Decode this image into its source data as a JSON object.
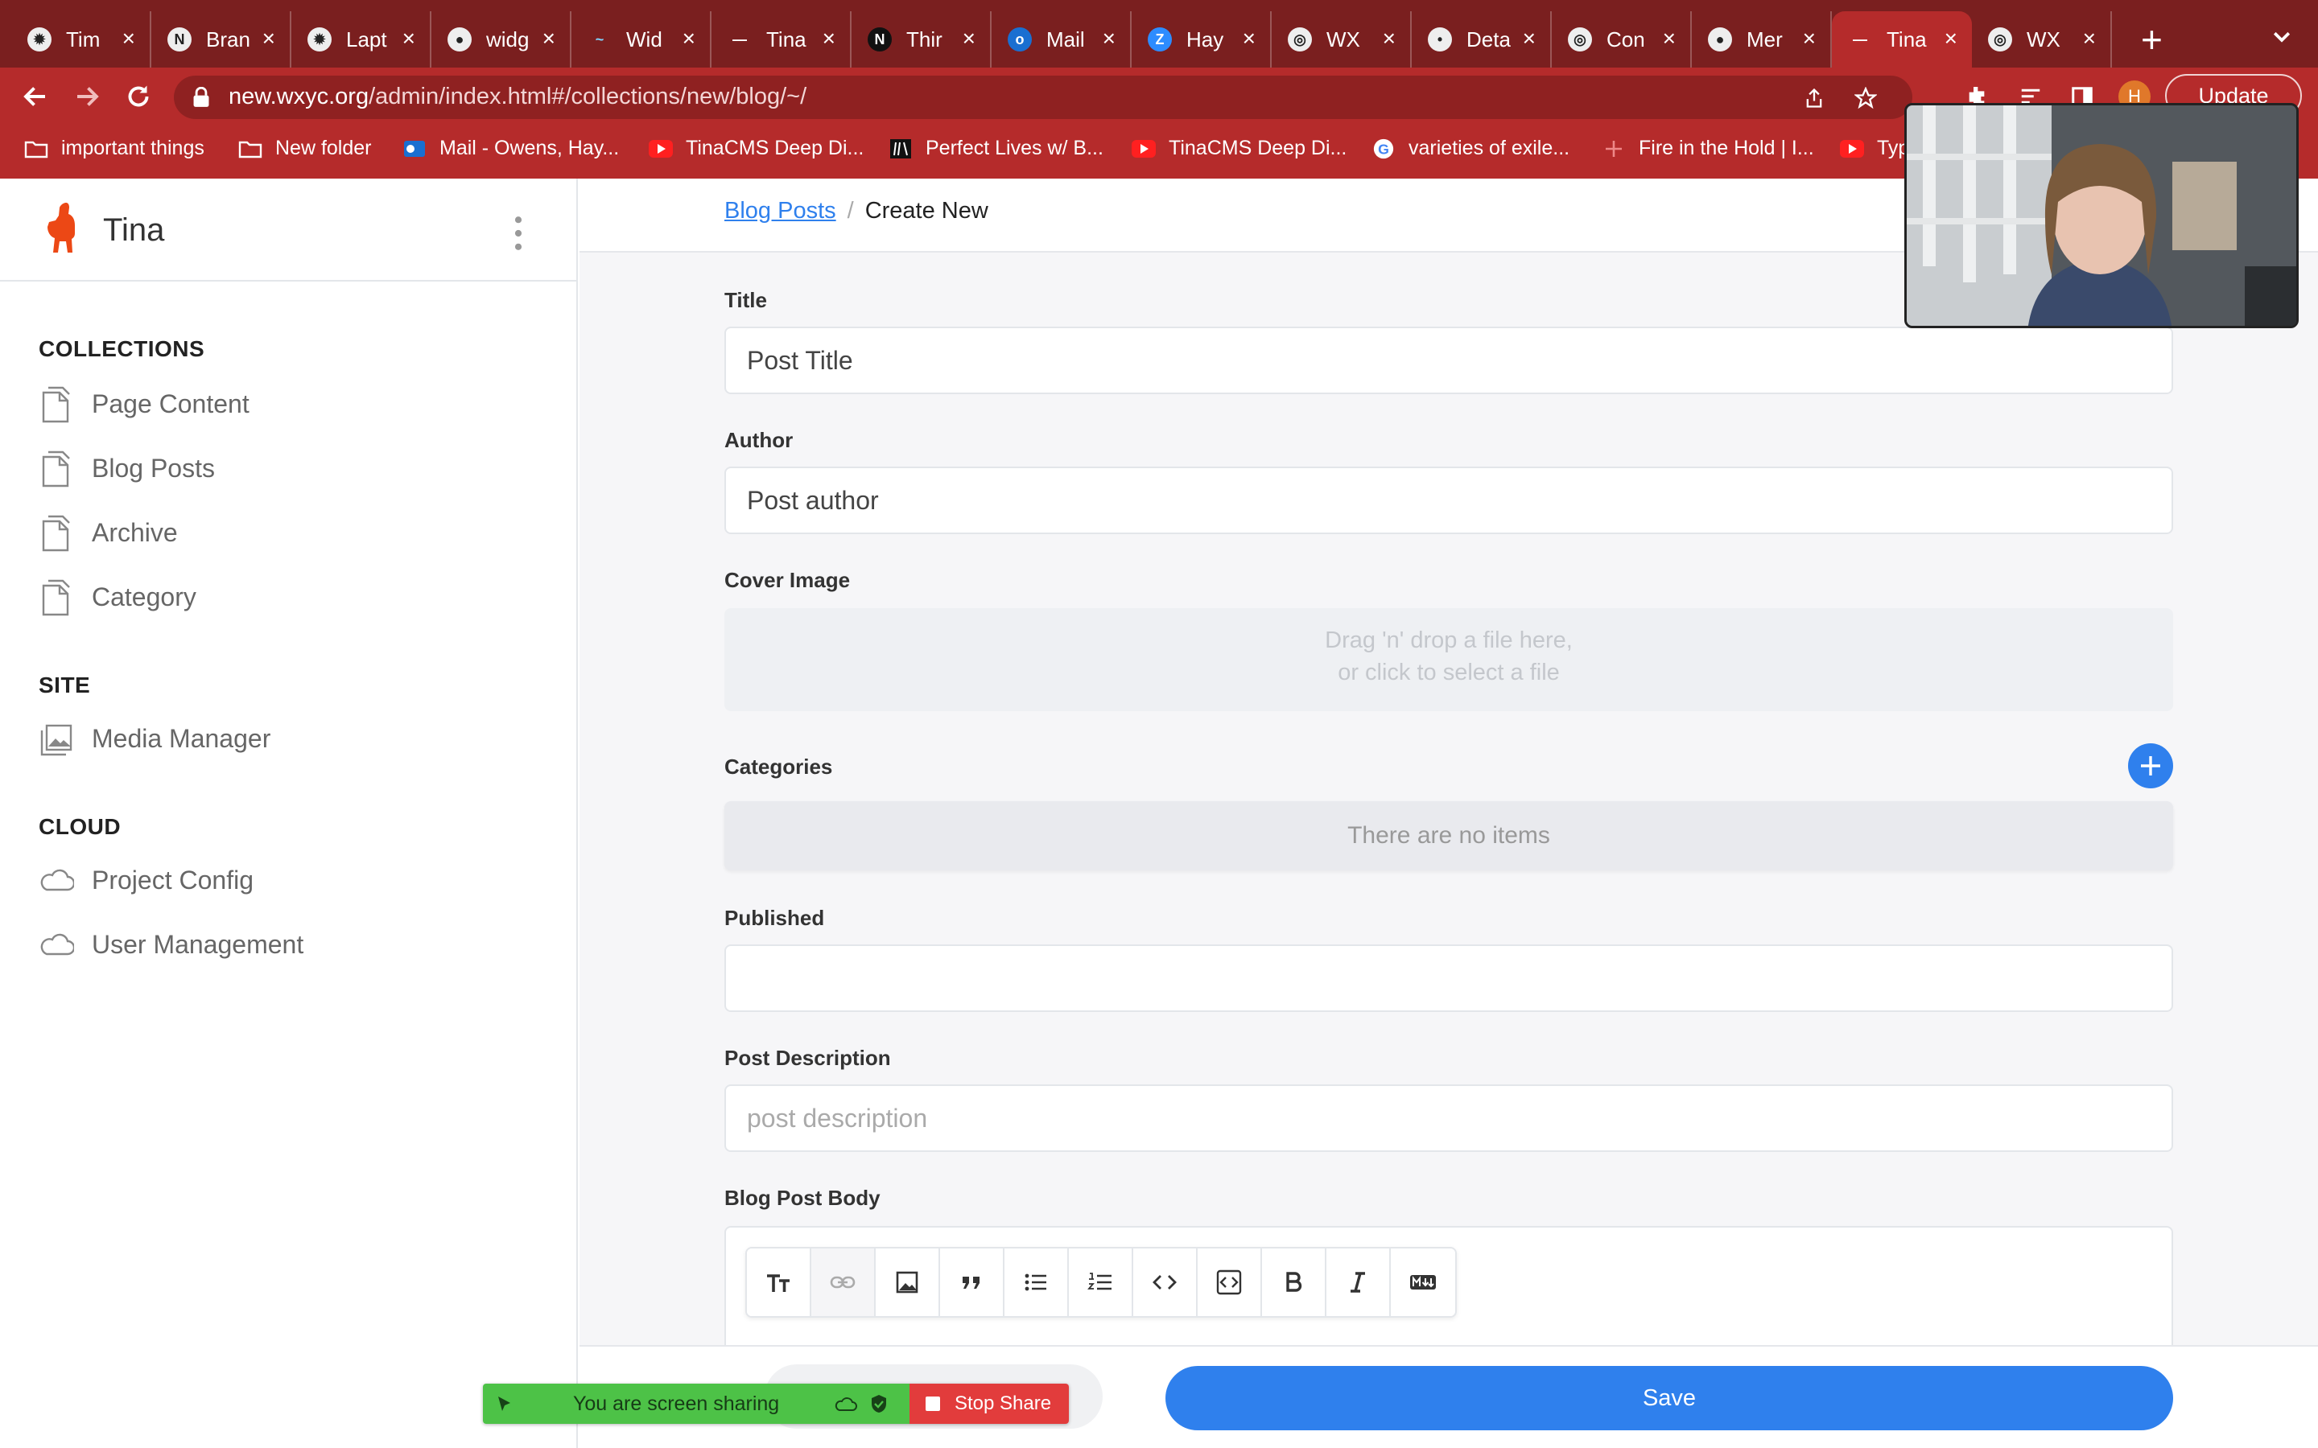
{
  "browser": {
    "tabs": [
      {
        "label": "Tim",
        "icon": "openai-icon",
        "active": false
      },
      {
        "label": "Bran",
        "icon": "notion-icon",
        "active": false
      },
      {
        "label": "Lapt",
        "icon": "chatgpt-icon",
        "active": false
      },
      {
        "label": "widg",
        "icon": "github-icon",
        "active": false
      },
      {
        "label": "Wid",
        "icon": "tailwind-icon",
        "active": false
      },
      {
        "label": "Tina",
        "icon": "wxyc-icon",
        "active": false
      },
      {
        "label": "Thir",
        "icon": "nextjs-icon",
        "active": false
      },
      {
        "label": "Mail",
        "icon": "outlook-icon",
        "active": false
      },
      {
        "label": "Hay",
        "icon": "zoom-icon",
        "active": false
      },
      {
        "label": "WX",
        "icon": "globe-icon",
        "active": false
      },
      {
        "label": "Deta",
        "icon": "site-icon",
        "active": false
      },
      {
        "label": "Con",
        "icon": "globe-icon",
        "active": false
      },
      {
        "label": "Mer",
        "icon": "github-icon",
        "active": false
      },
      {
        "label": "Tina",
        "icon": "wxyc-icon",
        "active": true
      },
      {
        "label": "WX",
        "icon": "globe-icon",
        "active": false
      }
    ],
    "url_host": "new.wxyc.org",
    "url_path": "/admin/index.html#/collections/new/blog/~/",
    "update_label": "Update",
    "profile_initial": "H",
    "bookmarks": [
      {
        "label": "important things",
        "icon": "folder-icon"
      },
      {
        "label": "New folder",
        "icon": "folder-icon"
      },
      {
        "label": "Mail - Owens, Hay...",
        "icon": "outlook-icon"
      },
      {
        "label": "TinaCMS Deep Di...",
        "icon": "youtube-icon"
      },
      {
        "label": "Perfect Lives w/ B...",
        "icon": "site-icon"
      },
      {
        "label": "TinaCMS Deep Di...",
        "icon": "youtube-icon"
      },
      {
        "label": "varieties of exile...",
        "icon": "google-icon"
      },
      {
        "label": "Fire in the Hold | I...",
        "icon": "plus-icon"
      },
      {
        "label": "Typ",
        "icon": "youtube-icon"
      }
    ]
  },
  "sidebar": {
    "brand": "Tina",
    "sections": [
      {
        "heading": "COLLECTIONS",
        "items": [
          "Page Content",
          "Blog Posts",
          "Archive",
          "Category"
        ]
      },
      {
        "heading": "SITE",
        "items": [
          "Media Manager"
        ]
      },
      {
        "heading": "CLOUD",
        "items": [
          "Project Config",
          "User Management"
        ]
      }
    ]
  },
  "main": {
    "breadcrumb": {
      "parent": "Blog Posts",
      "separator": "/",
      "current": "Create New"
    },
    "fields": {
      "title": {
        "label": "Title",
        "value": "Post Title"
      },
      "author": {
        "label": "Author",
        "value": "Post author"
      },
      "cover": {
        "label": "Cover Image",
        "drop_line1": "Drag 'n' drop a file here,",
        "drop_line2": "or click to select a file"
      },
      "categories": {
        "label": "Categories",
        "empty": "There are no items"
      },
      "published": {
        "label": "Published",
        "value": ""
      },
      "description": {
        "label": "Post Description",
        "placeholder": "post description"
      },
      "body": {
        "label": "Blog Post Body"
      }
    },
    "editor_tools": [
      "text-size-icon",
      "link-icon",
      "image-icon",
      "quote-icon",
      "bullet-list-icon",
      "numbered-list-icon",
      "code-icon",
      "code-block-icon",
      "bold-icon",
      "italic-icon",
      "markdown-icon"
    ],
    "save_label": "Save"
  },
  "screenshare": {
    "status": "You are screen sharing",
    "stop_label": "Stop Share"
  },
  "colors": {
    "accent": "#2f80ed",
    "chrome_tab_bar": "#7a1f1f",
    "chrome_toolbar": "#b52b2b",
    "share_green": "#4dc247",
    "share_red": "#e23c3c"
  }
}
